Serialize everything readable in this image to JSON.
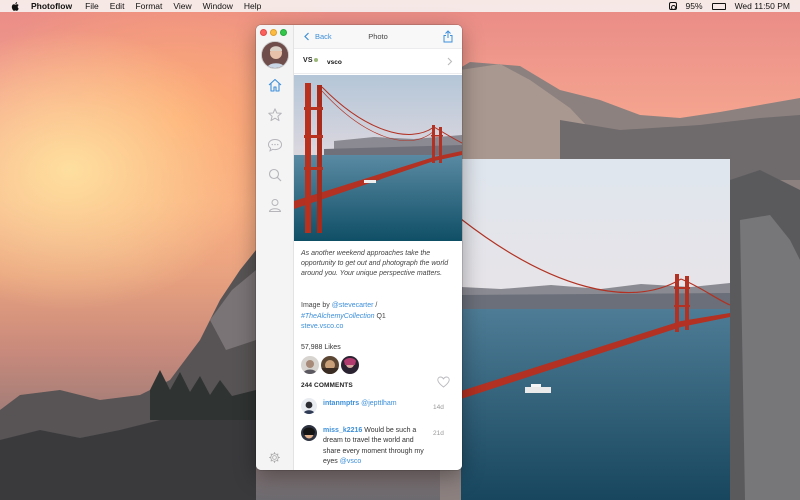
{
  "menubar": {
    "app_name": "Photoflow",
    "menus": [
      "File",
      "Edit",
      "Format",
      "View",
      "Window",
      "Help"
    ],
    "battery_percent": "95%",
    "battery_label": "",
    "clock": "Wed 11:50 PM"
  },
  "window": {
    "back_label": "Back",
    "title": "Photo",
    "account_logo": "VS",
    "account_name": "vsco"
  },
  "post": {
    "caption": "As another weekend approaches take the opportunity to get out and photograph the world around you. Your unique perspective matters.",
    "credit_prefix": "Image by ",
    "credit_user": "@stevecarter",
    "credit_sep": " /",
    "credit_hashtag": "#TheAlchemyCollection",
    "credit_suffix": " Q1",
    "credit_link": "steve.vsco.co",
    "likes": "57,988 Likes",
    "comments_count": "244 COMMENTS"
  },
  "comments": [
    {
      "user": "intanmptrs",
      "mention": "@jepttlham",
      "text": "",
      "time": "14d"
    },
    {
      "user": "miss_k2216",
      "text": "Would be such a dream to travel the world and share every moment through my eyes ",
      "mention": "@vsco",
      "time": "21d"
    }
  ],
  "colors": {
    "accent": "#3d8fd9",
    "bridge": "#c0392b",
    "sidebar": "#f4f4f5"
  },
  "icons": [
    "apple-icon",
    "instagram-icon",
    "battery-icon",
    "home-icon",
    "star-icon",
    "chat-icon",
    "search-icon",
    "profile-icon",
    "settings-icon",
    "share-icon",
    "heart-icon",
    "chevron-left-icon",
    "chevron-right-icon"
  ]
}
